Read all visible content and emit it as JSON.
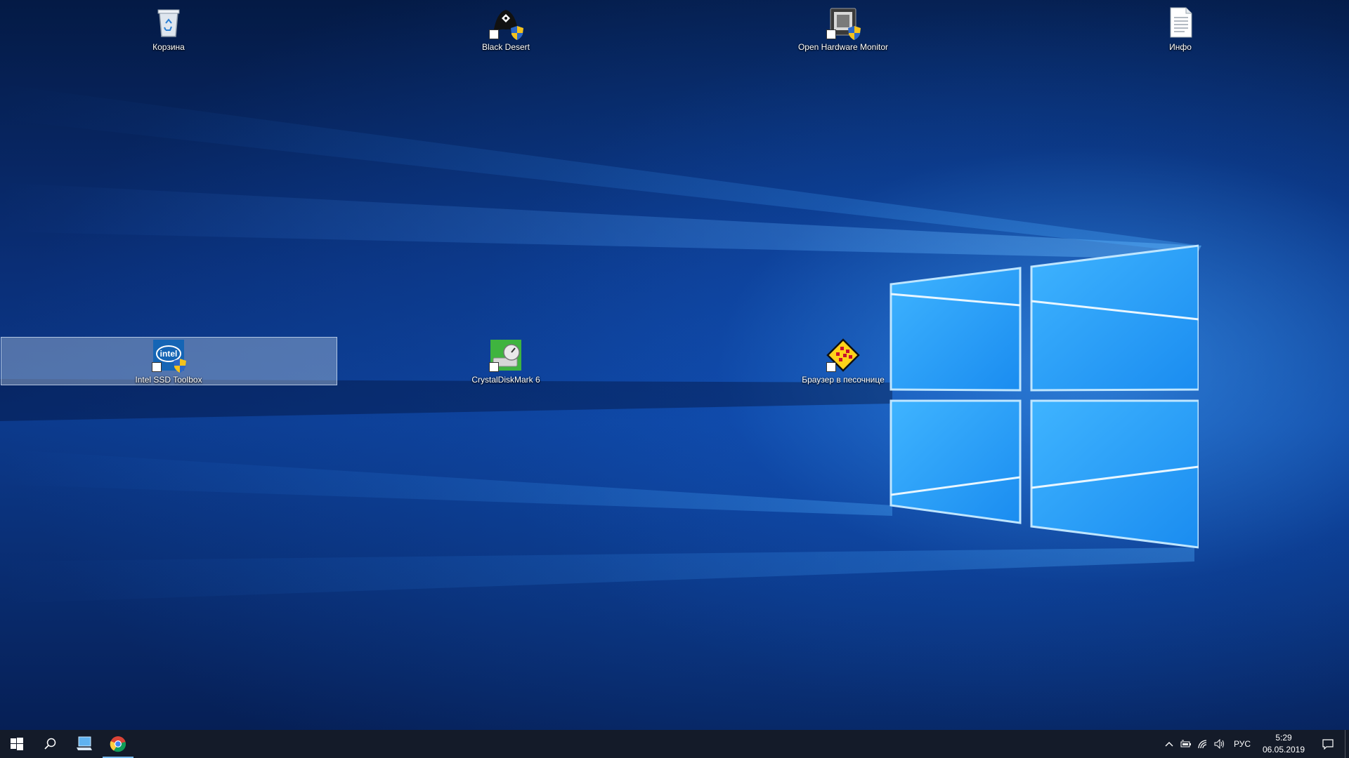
{
  "desktop": {
    "icons": [
      {
        "label": "Корзина",
        "icon": "recycle-bin-icon"
      },
      {
        "label": "Black Desert",
        "icon": "black-desert-icon"
      },
      {
        "label": "Open Hardware Monitor",
        "icon": "hardware-monitor-icon"
      },
      {
        "label": "Инфо",
        "icon": "text-file-icon"
      },
      {
        "label": "Intel SSD Toolbox",
        "icon": "intel-icon"
      },
      {
        "label": "CrystalDiskMark 6",
        "icon": "crystaldiskmark-icon"
      },
      {
        "label": "Браузер в песочнице",
        "icon": "sandbox-browser-icon"
      }
    ],
    "selected_icon": "Intel SSD Toolbox"
  },
  "taskbar": {
    "pinned": [
      {
        "icon": "windows-start-icon"
      },
      {
        "icon": "search-icon"
      },
      {
        "icon": "this-pc-icon"
      },
      {
        "icon": "chrome-icon",
        "active": true
      }
    ],
    "tray": {
      "icons": [
        "chevron-up-icon",
        "battery-icon",
        "network-icon",
        "volume-icon"
      ],
      "language": "РУС",
      "time": "5:29",
      "date": "06.05.2019"
    }
  },
  "colors": {
    "accent": "#76b9ed",
    "taskbar": "#0a1220",
    "wallpaper_glow": "#46aaff"
  }
}
